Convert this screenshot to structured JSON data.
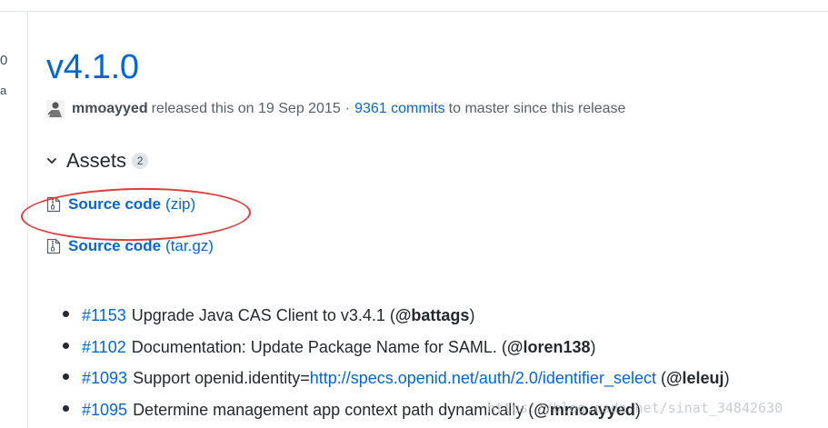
{
  "rail": {
    "text1": "0",
    "text2": "a"
  },
  "release": {
    "title": "v4.1.0",
    "author": "mmoayyed",
    "released_text": "released this on 19 Sep 2015",
    "separator": "·",
    "commits_link": "9361 commits",
    "commits_suffix": "to master since this release"
  },
  "assets": {
    "label": "Assets",
    "count": "2",
    "items": [
      {
        "name": "Source code",
        "ext": "(zip)",
        "icon": "file-zip-icon"
      },
      {
        "name": "Source code",
        "ext": "(tar.gz)",
        "icon": "file-zip-icon"
      }
    ]
  },
  "notes": [
    {
      "pr": "#1153",
      "text": "Upgrade Java CAS Client to v3.4.1 (",
      "mention": "@battags",
      "close": ")"
    },
    {
      "pr": "#1102",
      "text": "Documentation: Update Package Name for SAML. (",
      "mention": "@loren138",
      "close": ")"
    },
    {
      "pr": "#1093",
      "text": "Support openid.identity=",
      "link": "http://specs.openid.net/auth/2.0/identifier_select",
      "text2": " (",
      "mention": "@leleuj",
      "close": ")"
    },
    {
      "pr": "#1095",
      "text": "Determine management app context path dynamically (",
      "mention": "@mmoayyed",
      "close": ")"
    }
  ],
  "watermark": "https://blog.csdn.net/sinat_34842630",
  "colors": {
    "link": "#0366d6",
    "annotation_circle": "#e23b3b",
    "text": "#24292e"
  }
}
